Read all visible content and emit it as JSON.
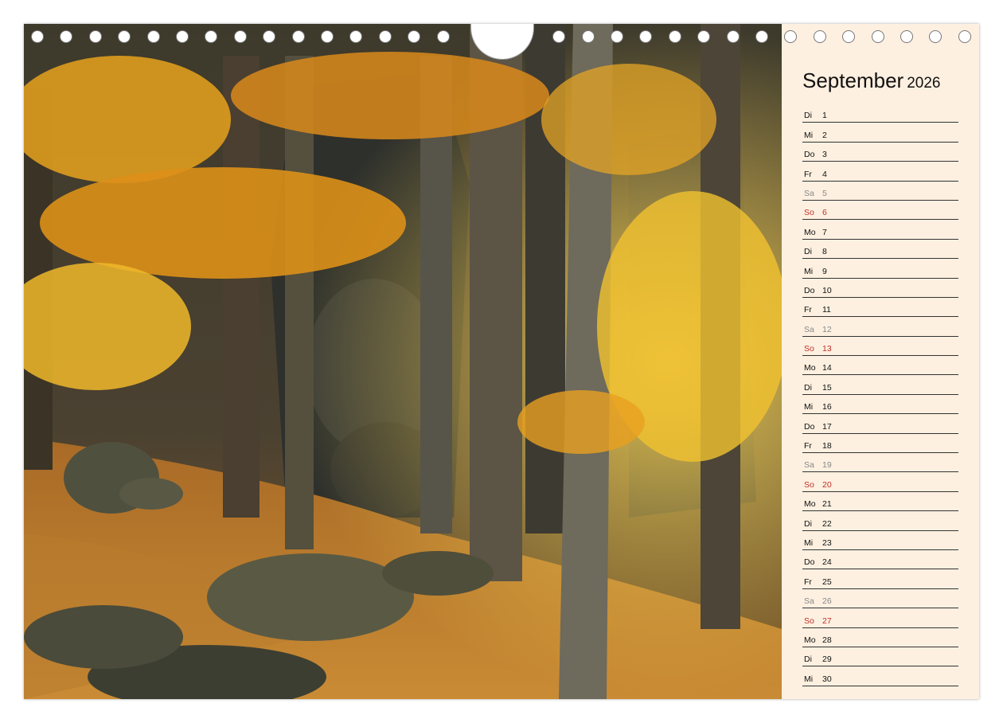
{
  "calendar": {
    "month": "September",
    "year": "2026",
    "days": [
      {
        "wd": "Di",
        "d": "1",
        "type": "weekday"
      },
      {
        "wd": "Mi",
        "d": "2",
        "type": "weekday"
      },
      {
        "wd": "Do",
        "d": "3",
        "type": "weekday"
      },
      {
        "wd": "Fr",
        "d": "4",
        "type": "weekday"
      },
      {
        "wd": "Sa",
        "d": "5",
        "type": "sat"
      },
      {
        "wd": "So",
        "d": "6",
        "type": "sun"
      },
      {
        "wd": "Mo",
        "d": "7",
        "type": "weekday"
      },
      {
        "wd": "Di",
        "d": "8",
        "type": "weekday"
      },
      {
        "wd": "Mi",
        "d": "9",
        "type": "weekday"
      },
      {
        "wd": "Do",
        "d": "10",
        "type": "weekday"
      },
      {
        "wd": "Fr",
        "d": "11",
        "type": "weekday"
      },
      {
        "wd": "Sa",
        "d": "12",
        "type": "sat"
      },
      {
        "wd": "So",
        "d": "13",
        "type": "sun"
      },
      {
        "wd": "Mo",
        "d": "14",
        "type": "weekday"
      },
      {
        "wd": "Di",
        "d": "15",
        "type": "weekday"
      },
      {
        "wd": "Mi",
        "d": "16",
        "type": "weekday"
      },
      {
        "wd": "Do",
        "d": "17",
        "type": "weekday"
      },
      {
        "wd": "Fr",
        "d": "18",
        "type": "weekday"
      },
      {
        "wd": "Sa",
        "d": "19",
        "type": "sat"
      },
      {
        "wd": "So",
        "d": "20",
        "type": "sun"
      },
      {
        "wd": "Mo",
        "d": "21",
        "type": "weekday"
      },
      {
        "wd": "Di",
        "d": "22",
        "type": "weekday"
      },
      {
        "wd": "Mi",
        "d": "23",
        "type": "weekday"
      },
      {
        "wd": "Do",
        "d": "24",
        "type": "weekday"
      },
      {
        "wd": "Fr",
        "d": "25",
        "type": "weekday"
      },
      {
        "wd": "Sa",
        "d": "26",
        "type": "sat"
      },
      {
        "wd": "So",
        "d": "27",
        "type": "sun"
      },
      {
        "wd": "Mo",
        "d": "28",
        "type": "weekday"
      },
      {
        "wd": "Di",
        "d": "29",
        "type": "weekday"
      },
      {
        "wd": "Mi",
        "d": "30",
        "type": "weekday"
      }
    ]
  },
  "colors": {
    "panel_background": "#fdf0e0",
    "sunday": "#c0302a",
    "saturday": "#888888",
    "foliage": "#e8a21c"
  },
  "photo": {
    "subject": "autumn beech forest with mossy boulders and rock faces"
  }
}
